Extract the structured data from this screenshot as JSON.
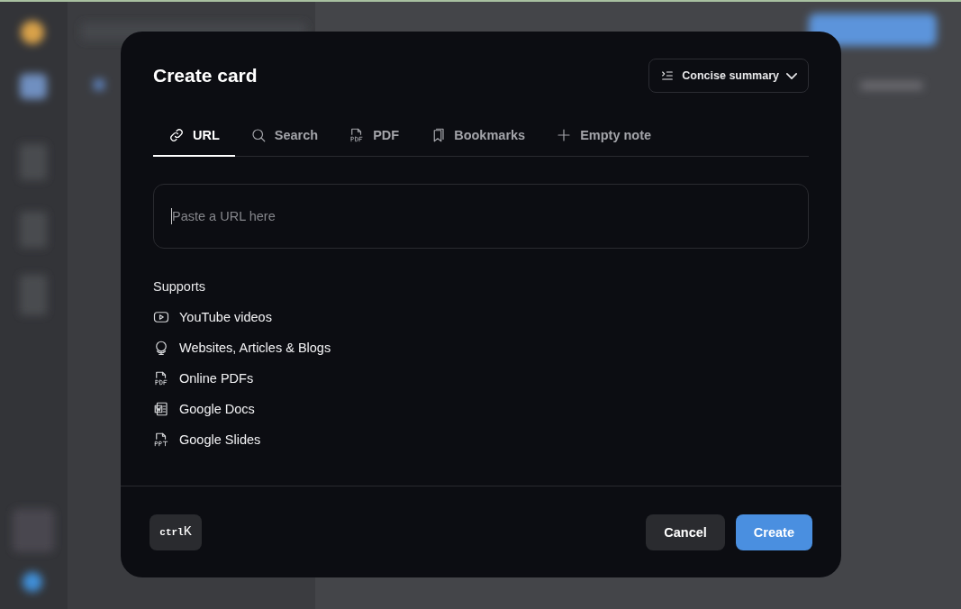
{
  "dialog": {
    "title": "Create card",
    "mode_dropdown": {
      "label": "Concise summary"
    },
    "tabs": [
      {
        "label": "URL",
        "kind": "link",
        "selected": true
      },
      {
        "label": "Search",
        "kind": "search",
        "selected": false
      },
      {
        "label": "PDF",
        "kind": "pdf",
        "selected": false
      },
      {
        "label": "Bookmarks",
        "kind": "bookmarks",
        "selected": false
      },
      {
        "label": "Empty note",
        "kind": "note",
        "selected": false
      }
    ],
    "url_field": {
      "placeholder": "Paste a URL here"
    },
    "supports": {
      "heading": "Supports",
      "items": [
        {
          "label": "YouTube videos",
          "kind": "video"
        },
        {
          "label": "Websites, Articles & Blogs",
          "kind": "web"
        },
        {
          "label": "Online PDFs",
          "kind": "pdf"
        },
        {
          "label": "Google Docs",
          "kind": "doc"
        },
        {
          "label": "Google Slides",
          "kind": "slides"
        }
      ]
    },
    "shortcut": {
      "keys": "ctrl",
      "key": "K"
    },
    "buttons": [
      {
        "label": "Cancel",
        "kind": "secondary"
      },
      {
        "label": "Create",
        "kind": "primary"
      }
    ]
  }
}
